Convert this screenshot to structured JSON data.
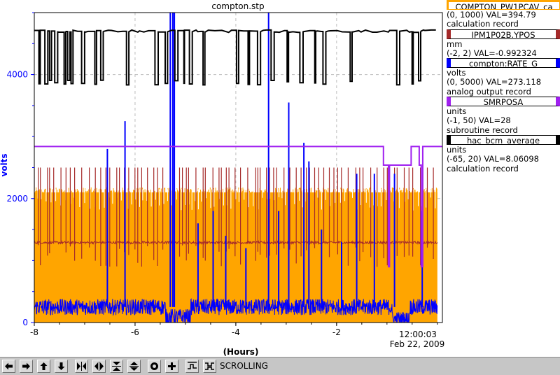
{
  "chart_data": {
    "type": "line",
    "title": "compton.stp",
    "xlabel": "(Hours)",
    "ylabel": "volts",
    "xlim": [
      -8,
      0.1
    ],
    "ylim": [
      0,
      5000
    ],
    "x_ticks": [
      "-8",
      "-6",
      "-4",
      "-2"
    ],
    "y_ticks": [
      "0",
      "2000",
      "4000"
    ],
    "end_time": "12:00:03",
    "end_date": "Feb 22, 2009",
    "grid": true,
    "series": [
      {
        "name": "COMPTON_PW1PCAV_ca",
        "color": "#ffa500",
        "range": "(0, 1000)",
        "val": "VAL=394.79",
        "type_label": "calculation record",
        "units": ""
      },
      {
        "name": "IPM1P02B.YPOS",
        "color": "#a52a2a",
        "units": "mm",
        "range": "(-2, 2)",
        "val": "VAL=-0.992324",
        "type_label": ""
      },
      {
        "name": "compton:RATE_G",
        "color": "#0000ff",
        "units": "volts",
        "range": "(0, 5000)",
        "val": "VAL=273.118",
        "type_label": "analog output record"
      },
      {
        "name": "SMRPOSA",
        "color": "#a020f0",
        "units": "units",
        "range": "(-1, 50)",
        "val": "VAL=28",
        "type_label": "subroutine record"
      },
      {
        "name": "hac_bcm_average",
        "color": "#000000",
        "units": "units",
        "range": "(-65, 20)",
        "val": "VAL=8.06098",
        "type_label": "calculation record"
      }
    ],
    "approx_levels": {
      "orange_band": [
        0,
        2100
      ],
      "brown_baseline": 1290,
      "brown_spike_top": 2500,
      "blue_baseline": 250,
      "purple_level": 2840,
      "purple_drops": [
        [
          -1.0,
          -0.2
        ],
        [
          -0.2,
          0.0
        ]
      ],
      "black_high": 4700,
      "black_low": 3830
    }
  },
  "toolbar": {
    "status_label": "SCROLLING",
    "buttons": [
      "arrow-left-icon",
      "arrow-right-icon",
      "arrow-up-icon",
      "arrow-down-icon",
      "zoom-in-x-icon",
      "zoom-out-x-icon",
      "zoom-in-y-icon",
      "zoom-out-y-icon",
      "auto-scale-icon",
      "add-icon",
      "stepped-plot-icon",
      "grid-icon"
    ]
  }
}
